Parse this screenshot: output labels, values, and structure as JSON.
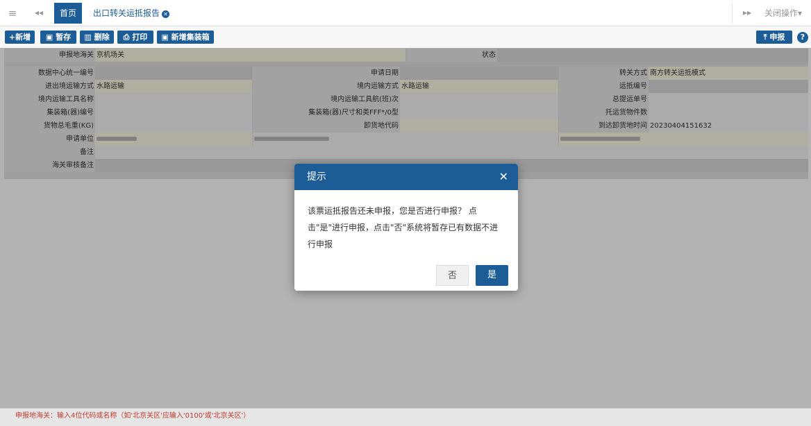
{
  "topbar": {
    "menu_icon": "≡",
    "prev_icon": "◀◀",
    "home_tab": "首页",
    "page_tab": "出口转关运抵报告",
    "close_tab_icon": "✕",
    "next_icon": "▶▶",
    "close_ops": "关闭操作▾"
  },
  "toolbar": {
    "add": "+新增",
    "save": "暂存",
    "delete": "删除",
    "print": "打印",
    "add_container": "新增集装箱",
    "declare": "申报",
    "help": "?"
  },
  "form": {
    "row1": [
      {
        "label": "申报地海关",
        "value": "京机场关"
      },
      {
        "label": "状态",
        "value": ""
      }
    ],
    "rows": [
      [
        {
          "label": "数据中心统一编号",
          "value": ""
        },
        {
          "label": "申请日期",
          "value": ""
        },
        {
          "label": "转关方式",
          "value": "南方转关运抵模式"
        }
      ],
      [
        {
          "label": "进出境运输方式",
          "value": "水路运输"
        },
        {
          "label": "境内运输方式",
          "value": "水路运输"
        },
        {
          "label": "运抵编号",
          "value": ""
        }
      ],
      [
        {
          "label": "境内运输工具名称",
          "value": ""
        },
        {
          "label": "境内运输工具航(班)次",
          "value": ""
        },
        {
          "label": "总提运单号",
          "value": ""
        }
      ],
      [
        {
          "label": "集装箱(器)编号",
          "value": ""
        },
        {
          "label": "集装箱(器)尺寸和类FFF*/0型",
          "value": ""
        },
        {
          "label": "托运货物件数",
          "value": ""
        }
      ],
      [
        {
          "label": "货物总毛重(KG)",
          "value": ""
        },
        {
          "label": "卸货地代码",
          "value": ""
        },
        {
          "label": "到达卸货地时间",
          "value": "20230404151632"
        }
      ]
    ],
    "applicant_label": "申请单位",
    "remark_label": "备注",
    "customs_remark_label": "海关审核备注"
  },
  "dialog": {
    "title": "提示",
    "close": "✕",
    "message_lines": [
      "该票运抵报告还未申报，您是否进行申报？ 点",
      "击\"是\"进行申报，点击\"否\"系统将暂存已有数据不进",
      "行申报"
    ],
    "no": "否",
    "yes": "是"
  },
  "footer": {
    "hint": "申报地海关：输入4位代码或名称（如'北京关区'应输入'0100'或'北京关区'）"
  },
  "colors": {
    "primary": "#1c5d98",
    "field_yellow": "#fbfbe6",
    "hint_red": "#c0392b"
  }
}
